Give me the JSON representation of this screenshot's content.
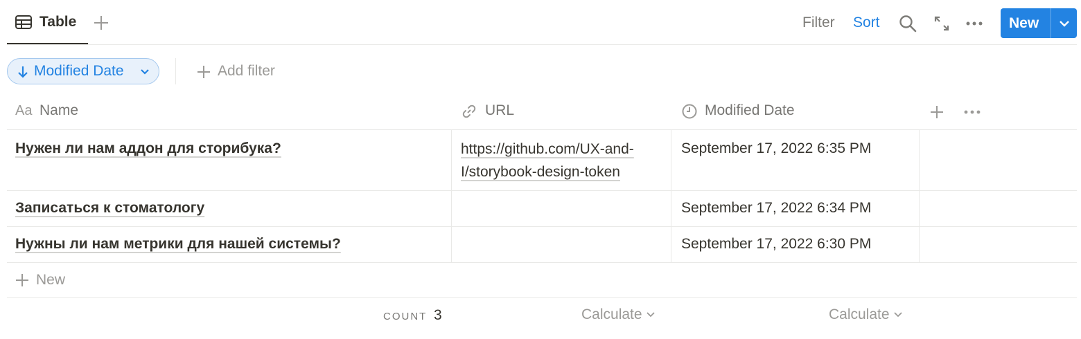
{
  "toolbar": {
    "view_tab_label": "Table",
    "filter_label": "Filter",
    "sort_label": "Sort",
    "new_button_label": "New",
    "accent_color": "#2383e2"
  },
  "filter_bar": {
    "sort_chip_label": "Modified Date",
    "add_filter_label": "Add filter"
  },
  "table": {
    "columns": [
      {
        "label": "Name",
        "icon": "Aa"
      },
      {
        "label": "URL",
        "icon": "link-icon"
      },
      {
        "label": "Modified Date",
        "icon": "clock-icon"
      }
    ],
    "rows": [
      {
        "name": "Нужен ли нам аддон для сторибука?",
        "url_line1": "https://github.com/UX-and-",
        "url_line2": "I/storybook-design-token",
        "modified": "September 17, 2022 6:35 PM"
      },
      {
        "name": "Записаться к стоматологу",
        "url_line1": "",
        "url_line2": "",
        "modified": "September 17, 2022 6:34 PM"
      },
      {
        "name": "Нужны ли нам метрики для нашей системы?",
        "url_line1": "",
        "url_line2": "",
        "modified": "September 17, 2022 6:30 PM"
      }
    ],
    "new_row_label": "New"
  },
  "footer": {
    "count_label": "COUNT",
    "count_value": "3",
    "calculate_url": "Calculate",
    "calculate_date": "Calculate"
  }
}
